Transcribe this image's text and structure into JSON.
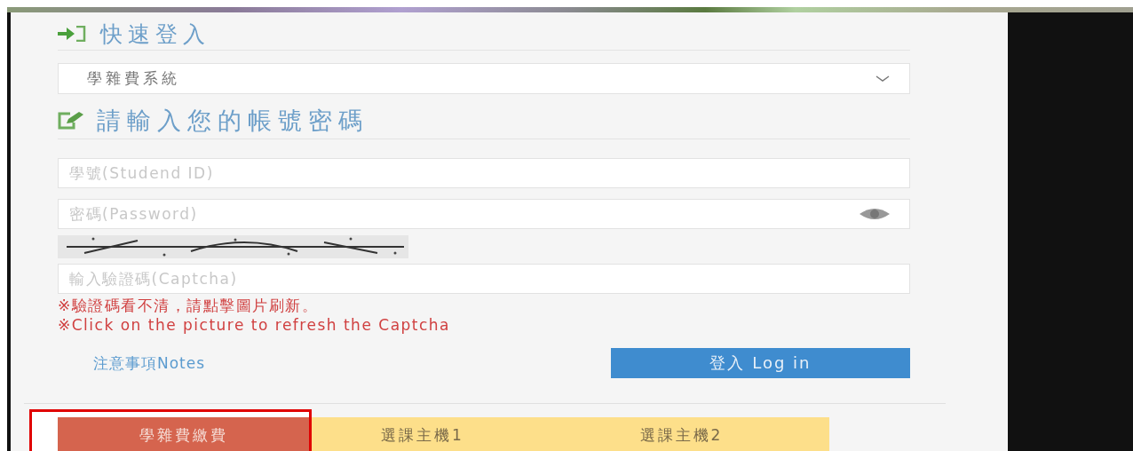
{
  "quick_login": {
    "title": "快速登入"
  },
  "system_select": {
    "value": "學雜費系統"
  },
  "login_heading": {
    "title": "請輸入您的帳號密碼"
  },
  "student_id_field": {
    "placeholder": "學號(Studend ID)"
  },
  "password_field": {
    "placeholder": "密碼(Password)"
  },
  "captcha_field": {
    "placeholder": "輸入驗證碼(Captcha)"
  },
  "notices": [
    "※驗證碼看不清，請點擊圖片刷新。",
    "※Click on the picture to refresh the Captcha"
  ],
  "notes_link": "注意事項Notes",
  "login_button": "登入 Log in",
  "tabs": [
    {
      "label": "學雜費繳費",
      "selected": true,
      "highlighted": true
    },
    {
      "label": "選課主機1",
      "selected": false,
      "highlighted": false
    },
    {
      "label": "選課主機2",
      "selected": false,
      "highlighted": false
    }
  ]
}
